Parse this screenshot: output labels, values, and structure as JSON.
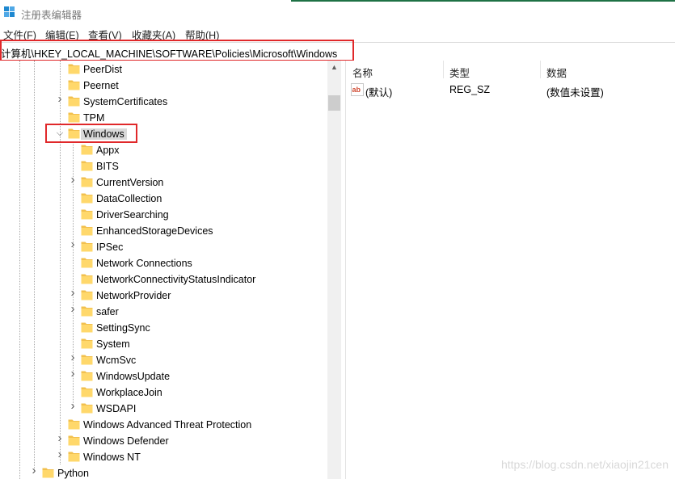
{
  "window": {
    "title": "注册表编辑器"
  },
  "menu": [
    "文件(F)",
    "编辑(E)",
    "查看(V)",
    "收藏夹(A)",
    "帮助(H)"
  ],
  "address": {
    "path": "计算机\\HKEY_LOCAL_MACHINE\\SOFTWARE\\Policies\\Microsoft\\Windows"
  },
  "tree": {
    "nodes": [
      {
        "label": "PeerDist",
        "level": 1,
        "expander": "none"
      },
      {
        "label": "Peernet",
        "level": 1,
        "expander": "none"
      },
      {
        "label": "SystemCertificates",
        "level": 1,
        "expander": "collapsed"
      },
      {
        "label": "TPM",
        "level": 1,
        "expander": "none"
      },
      {
        "label": "Windows",
        "level": 1,
        "expander": "expanded",
        "selected": true
      },
      {
        "label": "Appx",
        "level": 2,
        "expander": "none"
      },
      {
        "label": "BITS",
        "level": 2,
        "expander": "none"
      },
      {
        "label": "CurrentVersion",
        "level": 2,
        "expander": "collapsed"
      },
      {
        "label": "DataCollection",
        "level": 2,
        "expander": "none"
      },
      {
        "label": "DriverSearching",
        "level": 2,
        "expander": "none"
      },
      {
        "label": "EnhancedStorageDevices",
        "level": 2,
        "expander": "none"
      },
      {
        "label": "IPSec",
        "level": 2,
        "expander": "collapsed"
      },
      {
        "label": "Network Connections",
        "level": 2,
        "expander": "none"
      },
      {
        "label": "NetworkConnectivityStatusIndicator",
        "level": 2,
        "expander": "none"
      },
      {
        "label": "NetworkProvider",
        "level": 2,
        "expander": "collapsed"
      },
      {
        "label": "safer",
        "level": 2,
        "expander": "collapsed"
      },
      {
        "label": "SettingSync",
        "level": 2,
        "expander": "none"
      },
      {
        "label": "System",
        "level": 2,
        "expander": "none"
      },
      {
        "label": "WcmSvc",
        "level": 2,
        "expander": "collapsed"
      },
      {
        "label": "WindowsUpdate",
        "level": 2,
        "expander": "collapsed"
      },
      {
        "label": "WorkplaceJoin",
        "level": 2,
        "expander": "none"
      },
      {
        "label": "WSDAPI",
        "level": 2,
        "expander": "collapsed"
      },
      {
        "label": "Windows Advanced Threat Protection",
        "level": 1,
        "expander": "none"
      },
      {
        "label": "Windows Defender",
        "level": 1,
        "expander": "collapsed"
      },
      {
        "label": "Windows NT",
        "level": 1,
        "expander": "collapsed"
      },
      {
        "label": "Python",
        "level": 0,
        "expander": "collapsed"
      }
    ]
  },
  "columns": {
    "name": "名称",
    "type": "类型",
    "data": "数据"
  },
  "values": [
    {
      "name": "(默认)",
      "type": "REG_SZ",
      "data": "(数值未设置)"
    }
  ],
  "watermark": "https://blog.csdn.net/xiaojin21cen",
  "colors": {
    "highlight_box": "#e0282a",
    "folder": "#ffd86b",
    "selected_bg": "#d9d9d9"
  }
}
